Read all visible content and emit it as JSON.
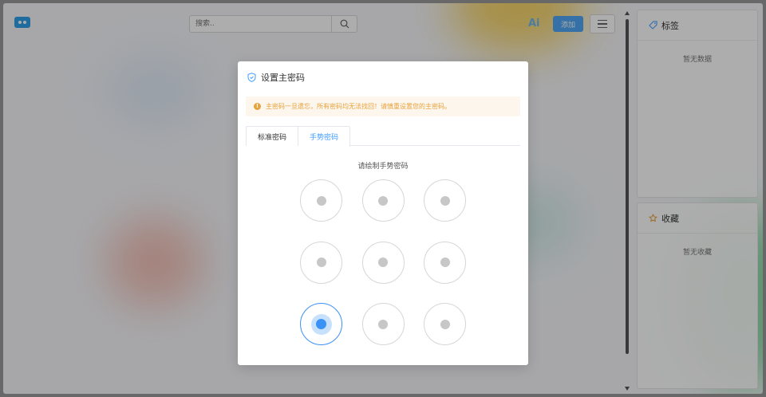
{
  "header": {
    "search_placeholder": "搜索..",
    "ai_label": "Ai",
    "add_label": "添加"
  },
  "sidebar": {
    "tags_title": "标签",
    "tags_empty": "暂无数据",
    "favorites_title": "收藏",
    "favorites_empty": "暂无收藏"
  },
  "modal": {
    "title": "设置主密码",
    "warning": "主密码一旦遗忘，所有密码均无法找回！请慎重设置您的主密码。",
    "tabs": [
      {
        "label": "标准密码",
        "active": false
      },
      {
        "label": "手势密码",
        "active": true
      }
    ],
    "gesture_hint": "请绘制手势密码",
    "gesture_grid": {
      "rows": 3,
      "cols": 3,
      "active_points": [
        6
      ]
    }
  },
  "colors": {
    "primary": "#409eff",
    "warning": "#e6a23c",
    "warning_bg": "#fdf6ec",
    "active_dot": "#3b91f5"
  },
  "icons": [
    "logo-icon",
    "search-icon",
    "menu-icon",
    "tag-icon",
    "star-icon",
    "shield-icon",
    "warning-icon"
  ]
}
